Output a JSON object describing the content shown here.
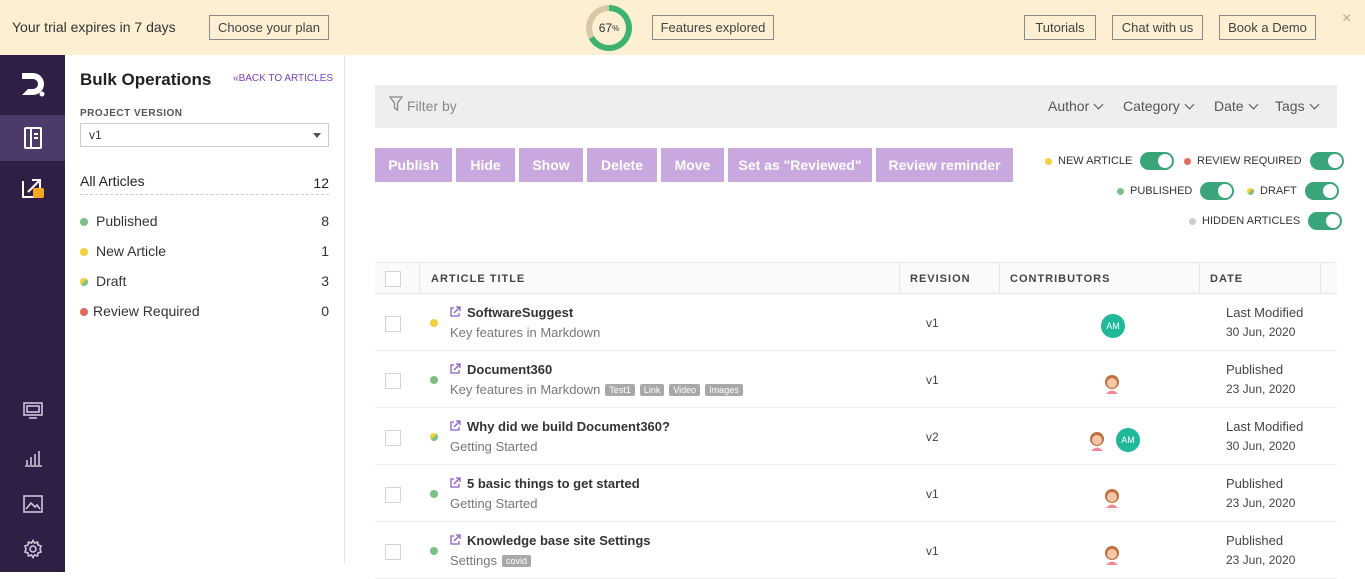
{
  "banner": {
    "trial_text": "Your trial expires in 7 days",
    "choose_plan": "Choose your plan",
    "progress_value": "67",
    "progress_unit": "%",
    "progress_fraction": 0.67,
    "features_explored": "Features explored",
    "tutorials": "Tutorials",
    "chat": "Chat with us",
    "demo": "Book a Demo",
    "close_glyph": "×"
  },
  "rail": {
    "items": [
      {
        "icon": "logo-icon"
      },
      {
        "icon": "documents-icon",
        "active": true
      },
      {
        "icon": "external-locked-icon"
      },
      {
        "icon": "monitor-icon"
      },
      {
        "icon": "analytics-icon"
      },
      {
        "icon": "image-icon"
      },
      {
        "icon": "gear-icon"
      }
    ]
  },
  "panel": {
    "title": "Bulk Operations",
    "back_link": "BACK TO ARTICLES",
    "project_version_label": "PROJECT VERSION",
    "project_version_value": "v1",
    "all_articles_label": "All Articles",
    "all_articles_count": "12",
    "stats": [
      {
        "label": "Published",
        "count": "8",
        "color": "#7dbf85"
      },
      {
        "label": "New Article",
        "count": "1",
        "color": "#f2d03b"
      },
      {
        "label": "Draft",
        "count": "3",
        "color": "mixed"
      },
      {
        "label": "Review Required",
        "count": "0",
        "color": "#e06a5e"
      }
    ]
  },
  "filter": {
    "placeholder": "Filter by",
    "author": "Author",
    "category": "Category",
    "date": "Date",
    "tags": "Tags"
  },
  "actions": {
    "publish": "Publish",
    "hide": "Hide",
    "show": "Show",
    "delete": "Delete",
    "move": "Move",
    "reviewed": "Set as \"Reviewed\"",
    "reminder": "Review reminder"
  },
  "toggles": {
    "new_article": "NEW ARTICLE",
    "review_required": "REVIEW REQUIRED",
    "published": "PUBLISHED",
    "draft": "DRAFT",
    "hidden": "HIDDEN ARTICLES"
  },
  "table": {
    "col_title": "ARTICLE TITLE",
    "col_revision": "REVISION",
    "col_contributors": "CONTRIBUTORS",
    "col_date": "DATE",
    "rows": [
      {
        "title": "SoftwareSuggest",
        "category": "Key features in Markdown",
        "tags": [],
        "revision": "v1",
        "date_label": "Last Modified",
        "date": "30 Jun, 2020"
      },
      {
        "title": "Document360",
        "category": "Key features in Markdown",
        "tags": [
          "Test1",
          "Link",
          "Video",
          "Images"
        ],
        "revision": "v1",
        "date_label": "Published",
        "date": "23 Jun, 2020"
      },
      {
        "title": "Why did we build Document360?",
        "category": "Getting Started",
        "tags": [],
        "revision": "v2",
        "date_label": "Last Modified",
        "date": "30 Jun, 2020"
      },
      {
        "title": "5 basic things to get started",
        "category": "Getting Started",
        "tags": [],
        "revision": "v1",
        "date_label": "Published",
        "date": "23 Jun, 2020"
      },
      {
        "title": "Knowledge base site Settings",
        "category": "Settings",
        "tags": [
          "covid"
        ],
        "revision": "v1",
        "date_label": "Published",
        "date": "23 Jun, 2020"
      }
    ],
    "avatar_initials": "AM"
  }
}
